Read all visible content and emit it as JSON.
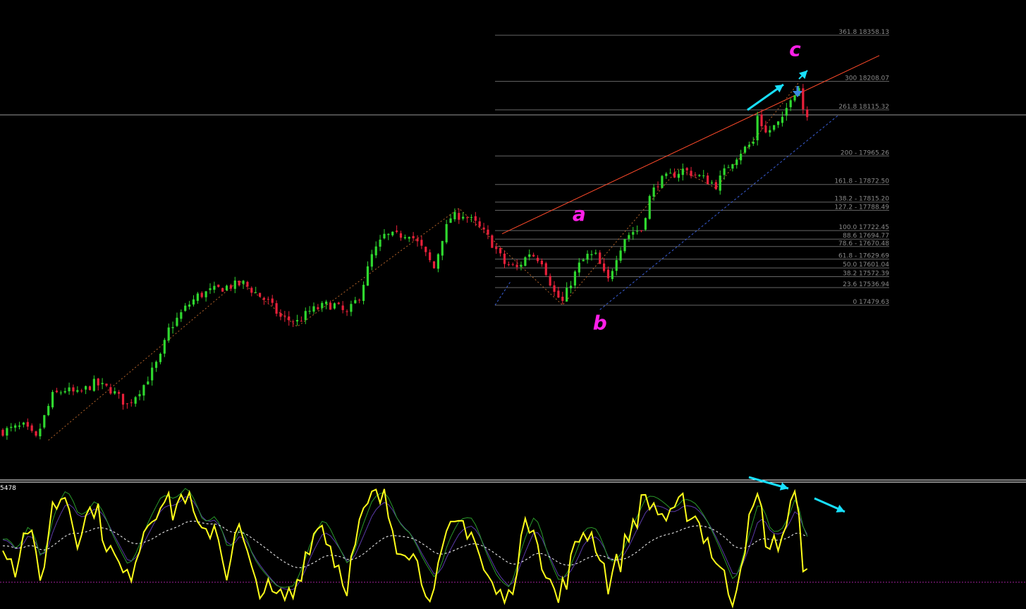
{
  "chart_data": {
    "type": "candlestick",
    "colors": {
      "background": "#000000",
      "bull": "#2fd82f",
      "bear": "#e8203a",
      "fib_line": "#666666",
      "fib_text": "#8a8a8a",
      "resistance": "#ff4a2a",
      "support_dashed": "#3a5fd8",
      "wave_label": "#ff1fe8",
      "arrow": "#18e0ff",
      "osc_main": "#ffff1a",
      "osc_signal": "#ffffff",
      "osc_green": "#2a9a2a",
      "osc_purple": "#5a3aa8",
      "osc_level": "#a0209a",
      "divider": "#ffffff"
    },
    "fib_levels": [
      {
        "label": "361.8 18358.13",
        "price": 18358.13
      },
      {
        "label": "300 18208.07",
        "price": 18208.07
      },
      {
        "label": "261.8 18115.32",
        "price": 18115.32
      },
      {
        "label": "200 - 17965.26",
        "price": 17965.26
      },
      {
        "label": "161.8 - 17872.50",
        "price": 17872.5
      },
      {
        "label": "138.2 - 17815.20",
        "price": 17815.2
      },
      {
        "label": "127.2 - 17788.49",
        "price": 17788.49
      },
      {
        "label": "100.0 17722.45",
        "price": 17722.45
      },
      {
        "label": "88.6 17694.77",
        "price": 17694.77
      },
      {
        "label": "78.6 - 17670.48",
        "price": 17670.48
      },
      {
        "label": "61.8 - 17629.69",
        "price": 17629.69
      },
      {
        "label": "50.0 17601.04",
        "price": 17601.04
      },
      {
        "label": "38.2 17572.39",
        "price": 17572.39
      },
      {
        "label": "23.6 17536.94",
        "price": 17536.94
      },
      {
        "label": "0 17479.63",
        "price": 17479.63
      }
    ],
    "wave_labels": [
      {
        "text": "a",
        "at_bar": 139
      },
      {
        "text": "b",
        "at_bar": 144
      },
      {
        "text": "c",
        "at_bar": 188
      }
    ],
    "oscillator_label": "5478",
    "oscillator_levels": [
      20,
      80
    ]
  }
}
